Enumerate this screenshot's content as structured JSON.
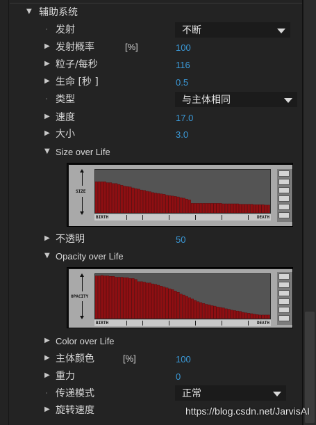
{
  "section": {
    "title": "辅助系统"
  },
  "rows": {
    "emit": {
      "label": "发射",
      "value": "不断"
    },
    "emit_rate": {
      "label": "发射概率",
      "unit": "[%]",
      "value": "100"
    },
    "particles_per_sec": {
      "label": "粒子/每秒",
      "value": "116"
    },
    "life": {
      "label": "生命 [秒 ]",
      "value": "0.5"
    },
    "type": {
      "label": "类型",
      "value": "与主体相同"
    },
    "speed": {
      "label": "速度",
      "value": "17.0"
    },
    "size": {
      "label": "大小",
      "value": "3.0"
    },
    "size_over_life": {
      "label": "Size over Life"
    },
    "opacity": {
      "label": "不透明",
      "value": "50"
    },
    "opacity_over_life": {
      "label": "Opacity over Life"
    },
    "color_over_life": {
      "label": "Color over Life"
    },
    "main_color": {
      "label": "主体颜色",
      "unit": "[%]",
      "value": "100"
    },
    "gravity": {
      "label": "重力",
      "value": "0"
    },
    "transfer_mode": {
      "label": "传递模式",
      "value": "正常"
    },
    "rotation_speed": {
      "label": "旋转速度"
    }
  },
  "graphs": {
    "size": {
      "ylabel": "SIZE",
      "x_start": "BIRTH",
      "x_end": "DEATH"
    },
    "opacity": {
      "ylabel": "OPACITY",
      "x_start": "BIRTH",
      "x_end": "DEATH"
    }
  },
  "chart_data": [
    {
      "type": "bar",
      "title": "",
      "ylabel": "SIZE",
      "xlabel": "BIRTH → DEATH",
      "ylim": [
        0,
        100
      ],
      "values": [
        72,
        72,
        72,
        72,
        70,
        70,
        68,
        68,
        66,
        64,
        62,
        61,
        60,
        58,
        56,
        55,
        53,
        52,
        50,
        49,
        47,
        46,
        45,
        44,
        43,
        41,
        40,
        39,
        38,
        37,
        35,
        34,
        32,
        30,
        22,
        22,
        22,
        22,
        22,
        22,
        22,
        22,
        22,
        22,
        22,
        21,
        21,
        21,
        21,
        21,
        21,
        20,
        20,
        20,
        20,
        20,
        19,
        19,
        19,
        19,
        18,
        18
      ]
    },
    {
      "type": "bar",
      "title": "",
      "ylabel": "OPACITY",
      "xlabel": "BIRTH → DEATH",
      "ylim": [
        0,
        100
      ],
      "values": [
        96,
        96,
        97,
        96,
        96,
        95,
        95,
        93,
        93,
        93,
        92,
        92,
        90,
        90,
        88,
        83,
        83,
        82,
        80,
        80,
        78,
        77,
        75,
        73,
        71,
        69,
        67,
        65,
        62,
        59,
        55,
        53,
        50,
        47,
        44,
        41,
        38,
        36,
        34,
        32,
        31,
        29,
        28,
        26,
        25,
        24,
        22,
        21,
        19,
        18,
        17,
        16,
        14,
        13,
        12,
        11,
        10,
        9,
        8,
        8,
        8,
        8
      ]
    }
  ],
  "watermark": "https://blog.csdn.net/JarvisAI"
}
